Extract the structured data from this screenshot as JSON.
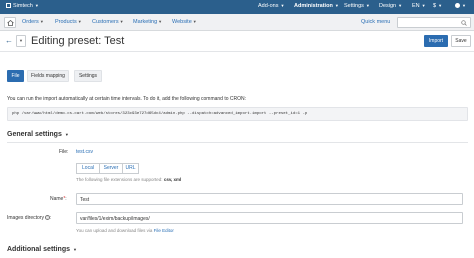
{
  "topbar": {
    "store": "Simtech",
    "addons": "Add-ons",
    "administration": "Administration",
    "settings": "Settings",
    "design": "Design",
    "language": "EN",
    "currency": "$"
  },
  "nav": {
    "orders": "Orders",
    "products": "Products",
    "customers": "Customers",
    "marketing": "Marketing",
    "website": "Website",
    "quick_menu": "Quick menu"
  },
  "title": "Editing preset: Test",
  "buttons": {
    "import": "Import",
    "save": "Save"
  },
  "tabs": [
    "File",
    "Fields mapping",
    "Settings"
  ],
  "cron": {
    "note": "You can run the import automatically at certain time intervals. To do it, add the following command to CRON:",
    "command": "php /var/www/html/demo.cs-cart.com/web/stores/323c93e727d65dc4/admin.php --dispatch=advanced_import.import --preset_id=1 -p"
  },
  "general_settings": "General settings",
  "file": {
    "label": "File:",
    "value": "test.csv",
    "sources": [
      "Local",
      "Server",
      "URL"
    ],
    "hint_prefix": "The following file extensions are supported:",
    "hint_exts": "csv, xml"
  },
  "name": {
    "label": "Name",
    "required_mark": "*",
    "value": "Test"
  },
  "images": {
    "label": "Images directory",
    "value": "var/files/1/exim/backup/images/",
    "hint_prefix": "You can upload and download files via",
    "hint_link": "File Editor"
  },
  "additional_settings": "Additional settings"
}
